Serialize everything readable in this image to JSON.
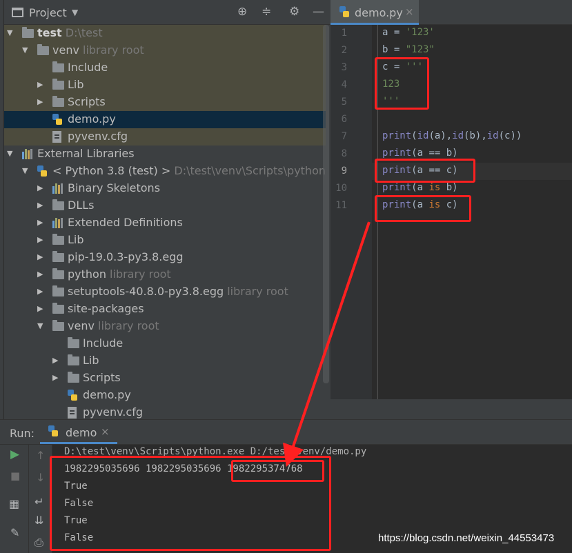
{
  "project_panel": {
    "title": "Project",
    "tree": [
      {
        "label": "test",
        "path": "D:\\test",
        "icon": "folder-icon",
        "expanded": true
      },
      {
        "label": "venv",
        "suffix": "library root",
        "icon": "folder-icon",
        "expanded": true
      },
      {
        "label": "Include",
        "icon": "folder-icon"
      },
      {
        "label": "Lib",
        "icon": "folder-icon",
        "expanded": false
      },
      {
        "label": "Scripts",
        "icon": "folder-icon",
        "expanded": false
      },
      {
        "label": "demo.py",
        "icon": "python-file-icon"
      },
      {
        "label": "pyvenv.cfg",
        "icon": "config-file-icon"
      },
      {
        "label": "External Libraries",
        "icon": "libraries-icon",
        "expanded": true
      },
      {
        "label": "< Python 3.8 (test) >",
        "suffix": "D:\\test\\venv\\Scripts\\python.exe",
        "icon": "python-sdk-icon",
        "expanded": true
      },
      {
        "label": "Binary Skeletons",
        "icon": "libraries-icon",
        "expanded": false
      },
      {
        "label": "DLLs",
        "icon": "folder-icon",
        "expanded": false
      },
      {
        "label": "Extended Definitions",
        "icon": "libraries-icon",
        "expanded": false
      },
      {
        "label": "Lib",
        "icon": "folder-icon",
        "expanded": false
      },
      {
        "label": "pip-19.0.3-py3.8.egg",
        "icon": "folder-icon",
        "expanded": false
      },
      {
        "label": "python",
        "suffix": "library root",
        "icon": "folder-icon",
        "expanded": false
      },
      {
        "label": "setuptools-40.8.0-py3.8.egg",
        "suffix": "library root",
        "icon": "folder-icon",
        "expanded": false
      },
      {
        "label": "site-packages",
        "icon": "folder-icon",
        "expanded": false
      },
      {
        "label": "venv",
        "suffix": "library root",
        "icon": "folder-icon",
        "expanded": true
      },
      {
        "label": "Include",
        "icon": "folder-icon"
      },
      {
        "label": "Lib",
        "icon": "folder-icon",
        "expanded": false
      },
      {
        "label": "Scripts",
        "icon": "folder-icon",
        "expanded": false
      },
      {
        "label": "demo.py",
        "icon": "python-file-icon"
      },
      {
        "label": "pyvenv.cfg",
        "icon": "config-file-icon"
      }
    ]
  },
  "editor": {
    "tab_label": "demo.py",
    "tab_close": "×",
    "line_numbers": [
      "1",
      "2",
      "3",
      "4",
      "5",
      "6",
      "7",
      "8",
      "9",
      "10",
      "11"
    ],
    "current_line": "9",
    "lines": [
      [
        {
          "t": "a = ",
          "c": ""
        },
        {
          "t": "'123'",
          "c": "str"
        }
      ],
      [
        {
          "t": "b = ",
          "c": ""
        },
        {
          "t": "\"123\"",
          "c": "str"
        }
      ],
      [
        {
          "t": "c = ",
          "c": ""
        },
        {
          "t": "'''",
          "c": "str"
        }
      ],
      [
        {
          "t": "123",
          "c": "str"
        }
      ],
      [
        {
          "t": "'''",
          "c": "str"
        }
      ],
      [],
      [
        {
          "t": "print",
          "c": "fn"
        },
        {
          "t": "(",
          "c": ""
        },
        {
          "t": "id",
          "c": "fn"
        },
        {
          "t": "(a),",
          "c": ""
        },
        {
          "t": "id",
          "c": "fn"
        },
        {
          "t": "(b),",
          "c": ""
        },
        {
          "t": "id",
          "c": "fn"
        },
        {
          "t": "(c))",
          "c": ""
        }
      ],
      [
        {
          "t": "print",
          "c": "fn"
        },
        {
          "t": "(a == b)",
          "c": ""
        }
      ],
      [
        {
          "t": "print",
          "c": "fn"
        },
        {
          "t": "(a == c)",
          "c": ""
        }
      ],
      [
        {
          "t": "print",
          "c": "fn"
        },
        {
          "t": "(a ",
          "c": ""
        },
        {
          "t": "is",
          "c": "kw"
        },
        {
          "t": " b)",
          "c": ""
        }
      ],
      [
        {
          "t": "print",
          "c": "fn"
        },
        {
          "t": "(a ",
          "c": ""
        },
        {
          "t": "is",
          "c": "kw"
        },
        {
          "t": " c)",
          "c": ""
        }
      ]
    ]
  },
  "run_panel": {
    "label": "Run:",
    "tab_label": "demo",
    "tab_close": "×",
    "command": "D:\\test\\venv\\Scripts\\python.exe D:/test/venv/demo.py",
    "output": [
      "1982295035696 1982295035696 1982295374768",
      "True",
      "False",
      "True",
      "False"
    ]
  },
  "watermark": "https://blog.csdn.net/weixin_44553473",
  "colors": {
    "annotation": "#ff2020",
    "selection": "#0d293e",
    "accent": "#4a88c7"
  }
}
